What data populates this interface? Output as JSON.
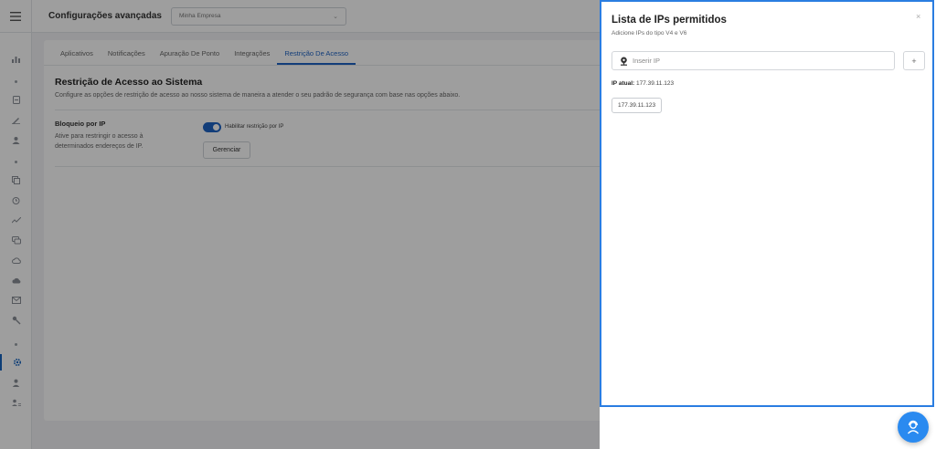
{
  "header": {
    "title": "Configurações avançadas",
    "company_select": "Minha Empresa",
    "menu_icon": "hamburger-icon"
  },
  "sidebar": {
    "icons": [
      "bar-chart-icon",
      "document-icon",
      "pen-icon",
      "users-icon",
      "copy-icon",
      "alarm-icon",
      "trend-icon",
      "chat-icon",
      "cloud-icon",
      "cloud-upload-icon",
      "mail-icon",
      "key-icon",
      "gear-icon",
      "person-icon",
      "person-list-icon"
    ],
    "active": "gear-icon"
  },
  "tabs": [
    {
      "label": "Aplicativos",
      "active": false
    },
    {
      "label": "Notificações",
      "active": false
    },
    {
      "label": "Apuração De Ponto",
      "active": false
    },
    {
      "label": "Integrações",
      "active": false
    },
    {
      "label": "Restrição De Acesso",
      "active": true
    }
  ],
  "section": {
    "title": "Restrição de Acesso ao Sistema",
    "description": "Configure as opções de restrição de acesso ao nosso sistema de maneira a atender o seu padrão de segurança com base nas opções abaixo."
  },
  "ip_block": {
    "title": "Bloqueio por IP",
    "description": "Ative para restringir o acesso à determinados endereços de IP.",
    "toggle_label": "Habilitar restrição por IP",
    "toggle_on": true,
    "manage_label": "Gerenciar"
  },
  "panel": {
    "title": "Lista de IPs permitidos",
    "subtitle": "Adicione IPs do tipo V4 e V6",
    "input_placeholder": "Inserir IP",
    "add_label": "+",
    "close_label": "×",
    "current_ip_label": "IP atual:",
    "current_ip_value": "177.39.11.123",
    "allowed_ips": [
      "177.39.11.123"
    ]
  },
  "colors": {
    "accent": "#1e63c4",
    "panel_border": "#2a7de1",
    "support_button": "#2a8af0"
  }
}
